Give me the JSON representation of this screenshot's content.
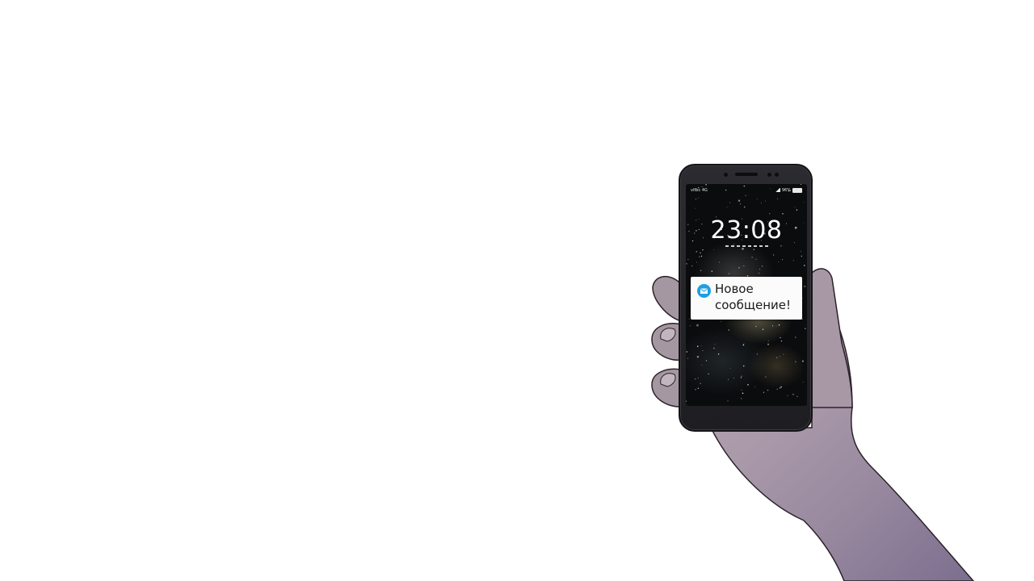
{
  "phone": {
    "status_bar": {
      "carrier": "vitbc 4G",
      "battery": "96%"
    },
    "lockscreen": {
      "time": "23:08"
    },
    "notification": {
      "icon": "mail-icon",
      "text": "Новое сообщение!",
      "accent_color": "#1e9fe3"
    }
  }
}
